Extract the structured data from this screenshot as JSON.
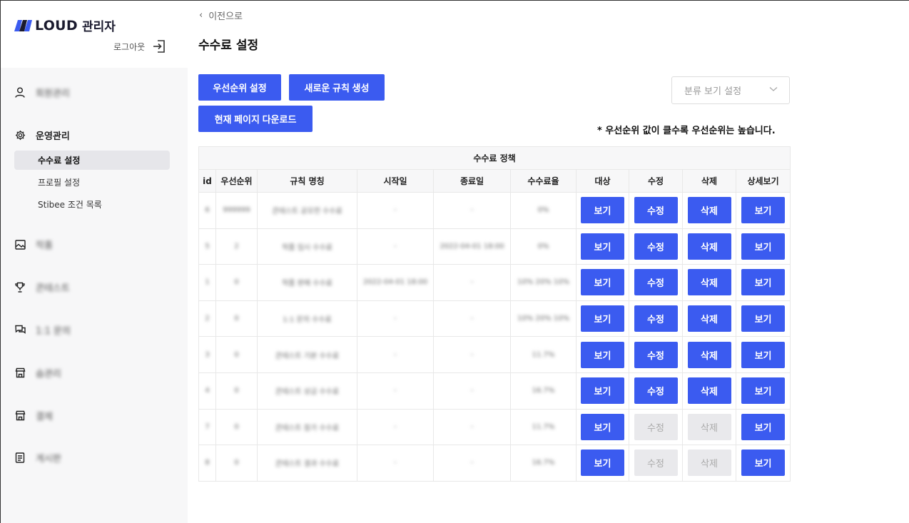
{
  "brand": {
    "name": "LOUD",
    "sub": "관리자",
    "logout": "로그아웃"
  },
  "sidebar": {
    "items": [
      {
        "icon": "user-icon",
        "label": "회원관리"
      },
      {
        "icon": "gear-icon",
        "label": "운영관리"
      },
      {
        "icon": "image-icon",
        "label": "작품"
      },
      {
        "icon": "trophy-icon",
        "label": "콘테스트"
      },
      {
        "icon": "chat-icon",
        "label": "1:1 문의"
      },
      {
        "icon": "store-icon",
        "label": "숍관리"
      },
      {
        "icon": "store-icon",
        "label": "결제"
      },
      {
        "icon": "list-icon",
        "label": "게시판"
      }
    ],
    "subitems": [
      "수수료 설정",
      "프로필 설정",
      "Stibee 조건 목록"
    ]
  },
  "back": "이전으로",
  "page_title": "수수료 설정",
  "buttons": {
    "priority": "우선순위 설정",
    "new_rule": "새로운 규칙 생성",
    "download": "현재 페이지 다운로드"
  },
  "filter": {
    "placeholder": "분류 보기 설정"
  },
  "note": "* 우선순위 값이 클수록 우선순위는 높습니다.",
  "table": {
    "caption": "수수료 정책",
    "headers": [
      "id",
      "우선순위",
      "규칙 명칭",
      "시작일",
      "종료일",
      "수수료율",
      "대상",
      "수정",
      "삭제",
      "상세보기"
    ],
    "view_label": "보기",
    "edit_label": "수정",
    "delete_label": "삭제",
    "rows": [
      {
        "id": "6",
        "priority": "999999",
        "name": "콘테스트 공모전 수수료",
        "start": "-",
        "end": "-",
        "rate": "0%",
        "editable": true
      },
      {
        "id": "5",
        "priority": "2",
        "name": "작품 임시 수수료",
        "start": "-",
        "end": "2022-04-01 18:00",
        "rate": "0%",
        "editable": true
      },
      {
        "id": "1",
        "priority": "0",
        "name": "작품 판매 수수료",
        "start": "2022-04-01 18:00",
        "end": "-",
        "rate": "10% 20% 10%",
        "editable": true
      },
      {
        "id": "2",
        "priority": "0",
        "name": "1:1 문의 수수료",
        "start": "-",
        "end": "-",
        "rate": "10% 20% 10%",
        "editable": true
      },
      {
        "id": "3",
        "priority": "0",
        "name": "콘테스트 기본 수수료",
        "start": "-",
        "end": "-",
        "rate": "11.7%",
        "editable": true
      },
      {
        "id": "4",
        "priority": "0",
        "name": "콘테스트 상금 수수료",
        "start": "-",
        "end": "-",
        "rate": "16.7%",
        "editable": true
      },
      {
        "id": "7",
        "priority": "0",
        "name": "콘테스트 참가 수수료",
        "start": "-",
        "end": "-",
        "rate": "11.7%",
        "editable": false
      },
      {
        "id": "8",
        "priority": "0",
        "name": "콘테스트 결과 수수료",
        "start": "-",
        "end": "-",
        "rate": "16.7%",
        "editable": false
      }
    ]
  },
  "colors": {
    "primary": "#3b5bf0",
    "disabled": "#e9e9ec",
    "sidebar_bg": "#f7f7f8"
  }
}
